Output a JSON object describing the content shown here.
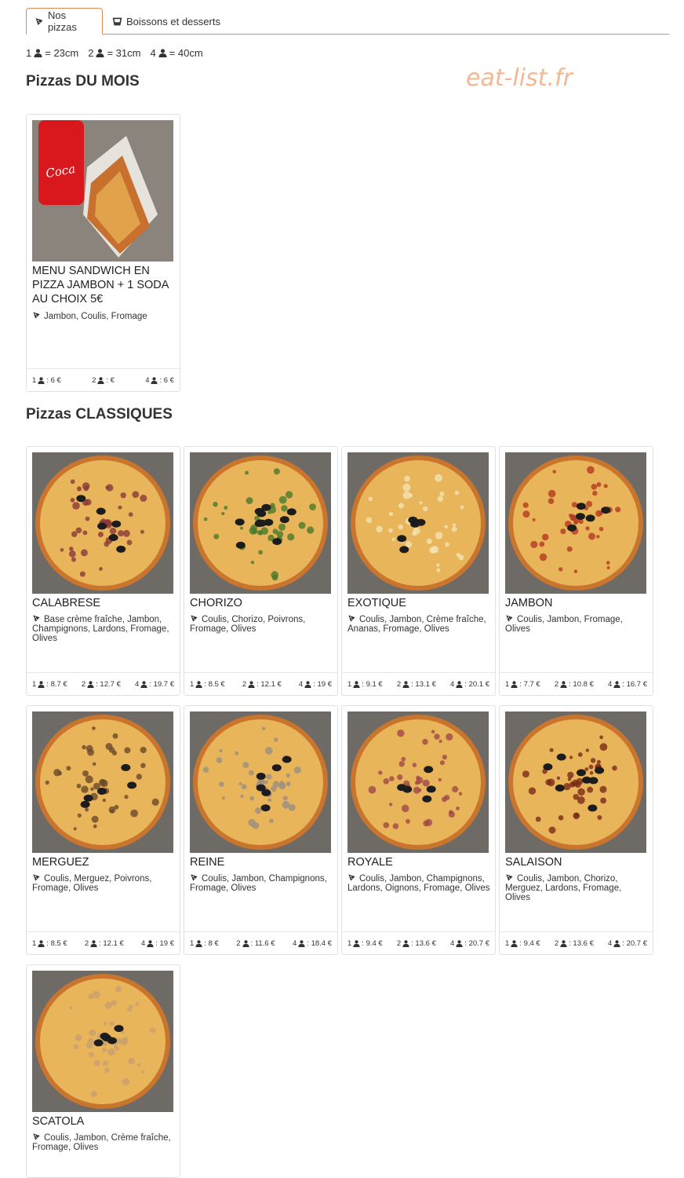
{
  "tabs": [
    {
      "label": "Nos pizzas",
      "icon": "pizza-slice-icon",
      "active": true
    },
    {
      "label": "Boissons et desserts",
      "icon": "cup-icon",
      "active": false
    }
  ],
  "legend": [
    {
      "count": "1",
      "text": "= 23cm"
    },
    {
      "count": "2",
      "text": "= 31cm"
    },
    {
      "count": "4",
      "text": "= 40cm"
    }
  ],
  "watermark": "eat-list.fr",
  "sections": {
    "mois": {
      "title": "Pizzas DU MOIS",
      "items": [
        {
          "name": "MENU SANDWICH EN PIZZA JAMBON + 1 SODA AU CHOIX 5€",
          "ingredients": "Jambon,  Coulis,  Fromage",
          "prices": [
            {
              "n": "1",
              "v": ": 6 €"
            },
            {
              "n": "2",
              "v": ": €"
            },
            {
              "n": "4",
              "v": ": 6 €"
            }
          ]
        }
      ]
    },
    "classiques": {
      "title": "Pizzas CLASSIQUES",
      "items": [
        {
          "name": "CALABRESE",
          "ingredients": "Base crème fraîche,  Jambon,  Champignons,  Lardons,  Fromage,  Olives",
          "prices": [
            {
              "n": "1",
              "v": ": 8.7 €"
            },
            {
              "n": "2",
              "v": ": 12.7 €"
            },
            {
              "n": "4",
              "v": ": 19.7 €"
            }
          ]
        },
        {
          "name": "CHORIZO",
          "ingredients": "Coulis,  Chorizo,  Poivrons,  Fromage,  Olives",
          "prices": [
            {
              "n": "1",
              "v": ": 8.5 €"
            },
            {
              "n": "2",
              "v": ": 12.1 €"
            },
            {
              "n": "4",
              "v": ": 19 €"
            }
          ]
        },
        {
          "name": "EXOTIQUE",
          "ingredients": "Coulis,  Jambon,  Crème fraîche,  Ananas,  Fromage,  Olives",
          "prices": [
            {
              "n": "1",
              "v": ": 9.1 €"
            },
            {
              "n": "2",
              "v": ": 13.1 €"
            },
            {
              "n": "4",
              "v": ": 20.1 €"
            }
          ]
        },
        {
          "name": "JAMBON",
          "ingredients": "Coulis,  Jambon,  Fromage,  Olives",
          "prices": [
            {
              "n": "1",
              "v": ": 7.7 €"
            },
            {
              "n": "2",
              "v": ": 10.8 €"
            },
            {
              "n": "4",
              "v": ": 16.7 €"
            }
          ]
        },
        {
          "name": "MERGUEZ",
          "ingredients": "Coulis,  Merguez,  Poivrons,  Fromage,  Olives",
          "prices": [
            {
              "n": "1",
              "v": ": 8.5 €"
            },
            {
              "n": "2",
              "v": ": 12.1 €"
            },
            {
              "n": "4",
              "v": ": 19 €"
            }
          ]
        },
        {
          "name": "REINE",
          "ingredients": "Coulis,  Jambon,  Champignons,  Fromage,  Olives",
          "prices": [
            {
              "n": "1",
              "v": ": 8 €"
            },
            {
              "n": "2",
              "v": ": 11.6 €"
            },
            {
              "n": "4",
              "v": ": 18.4 €"
            }
          ]
        },
        {
          "name": "ROYALE",
          "ingredients": "Coulis,  Jambon,  Champignons,  Lardons,  Oignons,  Fromage,  Olives",
          "prices": [
            {
              "n": "1",
              "v": ": 9.4 €"
            },
            {
              "n": "2",
              "v": ": 13.6 €"
            },
            {
              "n": "4",
              "v": ": 20.7 €"
            }
          ]
        },
        {
          "name": "SALAISON",
          "ingredients": "Coulis,  Jambon,  Chorizo,  Merguez,  Lardons,  Fromage,  Olives",
          "prices": [
            {
              "n": "1",
              "v": ": 9.4 €"
            },
            {
              "n": "2",
              "v": ": 13.6 €"
            },
            {
              "n": "4",
              "v": ": 20.7 €"
            }
          ]
        },
        {
          "name": "SCATOLA",
          "ingredients": "Coulis,  Jambon,  Crème fraîche,  Fromage,  Olives",
          "prices": []
        }
      ]
    }
  },
  "colors": {
    "accent": "#e08a5a",
    "watermark": "#f0a070"
  }
}
